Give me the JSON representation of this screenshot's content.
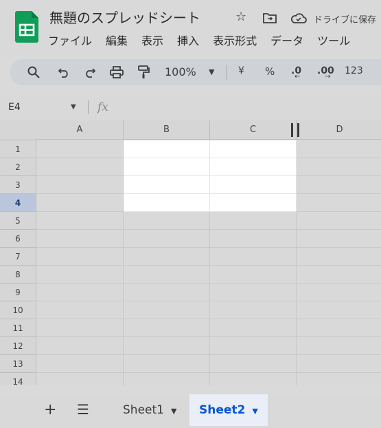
{
  "app": {
    "doc_title": "無題のスプレッドシート",
    "drive_status": "ドライブに保存",
    "brand_color": "#0f9d58"
  },
  "menu": [
    "ファイル",
    "編集",
    "表示",
    "挿入",
    "表示形式",
    "データ",
    "ツール"
  ],
  "toolbar": {
    "zoom": "100%",
    "currency": "¥",
    "percent": "%",
    "dec_decrease": ".0",
    "dec_increase": ".00",
    "number_format": "123"
  },
  "formula_bar": {
    "name_box": "E4",
    "fx": "fx"
  },
  "grid": {
    "columns": [
      "A",
      "B",
      "C",
      "D"
    ],
    "rows": [
      "1",
      "2",
      "3",
      "4",
      "5",
      "6",
      "7",
      "8",
      "9",
      "10",
      "11",
      "12",
      "13",
      "14"
    ],
    "selected_row": "4",
    "highlight_color": "#ffffff"
  },
  "sheets": {
    "tabs": [
      "Sheet1",
      "Sheet2"
    ],
    "active": "Sheet2",
    "active_color": "#0b57d0"
  }
}
